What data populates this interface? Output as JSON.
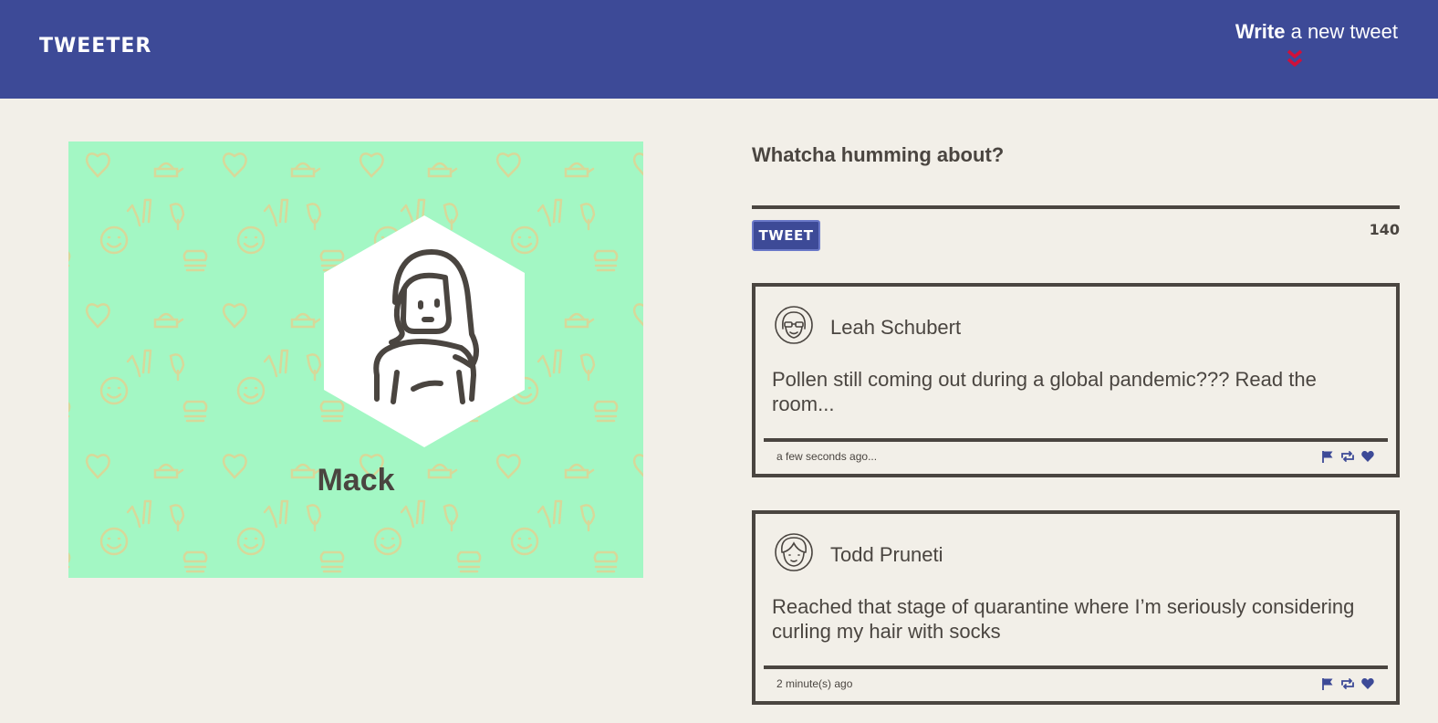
{
  "nav": {
    "brand": "TWEETER",
    "compose_bold": "Write",
    "compose_rest": " a new tweet",
    "arrow_color": "#d0103a"
  },
  "colors": {
    "nav": "#3d4a97",
    "page": "#f2efe8",
    "profile_bg": "#a3f7c4",
    "text": "#4a4540",
    "icon": "#3d4a97"
  },
  "profile": {
    "name": "Mack",
    "avatar_icon": "user-avatar-icon"
  },
  "composer": {
    "prompt": "Whatcha humming about?",
    "input_value": "",
    "button_label": "TWEET",
    "counter": "140"
  },
  "tweets": [
    {
      "author": "Leah Schubert",
      "avatar_icon": "avatar-woman-sunglasses-icon",
      "body": "Pollen still coming out during a global pandemic??? Read the room...",
      "time": "a few seconds ago...",
      "actions": [
        "flag-icon",
        "retweet-icon",
        "heart-icon"
      ]
    },
    {
      "author": "Todd Pruneti",
      "avatar_icon": "avatar-man-icon",
      "body": "Reached that stage of quarantine where I’m seriously considering curling my hair with socks",
      "time": "2 minute(s) ago",
      "actions": [
        "flag-icon",
        "retweet-icon",
        "heart-icon"
      ]
    }
  ]
}
